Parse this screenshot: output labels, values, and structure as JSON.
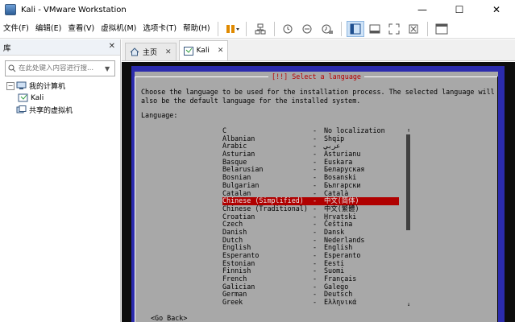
{
  "window": {
    "title": "Kali - VMware Workstation",
    "minimize": "—",
    "maximize": "☐",
    "close": "✕"
  },
  "menu": [
    "文件(F)",
    "编辑(E)",
    "查看(V)",
    "虚拟机(M)",
    "选项卡(T)",
    "帮助(H)"
  ],
  "sidebar": {
    "title": "库",
    "close": "✕",
    "search_placeholder": "在此处键入内容进行搜...",
    "tree": {
      "my_computer": "我的计算机",
      "vm": "Kali",
      "shared": "共享的虚拟机"
    }
  },
  "tabs": [
    {
      "label": "主页",
      "icon": "home-icon"
    },
    {
      "label": "Kali",
      "icon": "vm-icon"
    }
  ],
  "tab_close": "✕",
  "installer": {
    "title": "[!!] Select a language",
    "description": "Choose the language to be used for the installation process. The selected language will\nalso be the default language for the installed system.",
    "language_label": "Language:",
    "go_back": "<Go Back>",
    "scroll_up": "↑",
    "scroll_down": "↓",
    "languages": [
      [
        "C",
        "No localization"
      ],
      [
        "Albanian",
        "Shqip"
      ],
      [
        "Arabic",
        "عربي"
      ],
      [
        "Asturian",
        "Asturianu"
      ],
      [
        "Basque",
        "Euskara"
      ],
      [
        "Belarusian",
        "Беларуская"
      ],
      [
        "Bosnian",
        "Bosanski"
      ],
      [
        "Bulgarian",
        "Български"
      ],
      [
        "Catalan",
        "Català"
      ],
      [
        "Chinese (Simplified)",
        "中文(简体)"
      ],
      [
        "Chinese (Traditional)",
        "中文(繁體)"
      ],
      [
        "Croatian",
        "Hrvatski"
      ],
      [
        "Czech",
        "Čeština"
      ],
      [
        "Danish",
        "Dansk"
      ],
      [
        "Dutch",
        "Nederlands"
      ],
      [
        "English",
        "English"
      ],
      [
        "Esperanto",
        "Esperanto"
      ],
      [
        "Estonian",
        "Eesti"
      ],
      [
        "Finnish",
        "Suomi"
      ],
      [
        "French",
        "Français"
      ],
      [
        "Galician",
        "Galego"
      ],
      [
        "German",
        "Deutsch"
      ],
      [
        "Greek",
        "Ελληνικά"
      ]
    ],
    "selected_index": 9,
    "dash": "-"
  },
  "colors": {
    "vm_background": "#2b2bad",
    "dialog_background": "#a8a8a8",
    "selection": "#b00000",
    "title_text": "#b80000"
  }
}
